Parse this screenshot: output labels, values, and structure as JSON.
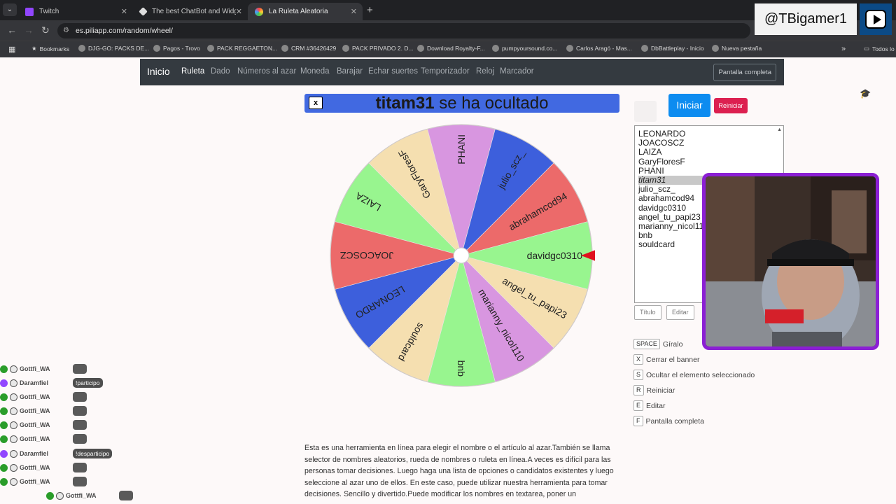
{
  "browser": {
    "tabs": [
      {
        "title": "Twitch",
        "color": "#9146ff"
      },
      {
        "title": "The best ChatBot and Widgets",
        "color": "#cccccc"
      },
      {
        "title": "La Ruleta Aleatoria",
        "color": "#f0a030"
      }
    ],
    "url": "es.piliapp.com/random/wheel/",
    "bookmarks": [
      "Bookmarks",
      "DJG-GO: PACKS DE...",
      "Pagos - Trovo",
      "PACK REGGAETON...",
      "CRM #36426429",
      "PACK PRIVADO 2. D...",
      "Download Royalty-F...",
      "pumpyoursound.co...",
      "Carlos Aragó - Mas...",
      "DbBattleplay - Inicio",
      "Nueva pestaña"
    ],
    "bookmarks_overflow": "»",
    "all_bookmarks": "Todos lo"
  },
  "nav": {
    "brand": "Inicio",
    "links": [
      "Ruleta",
      "Dado",
      "Números al azar",
      "Moneda",
      "Barajar",
      "Echar suertes",
      "Temporizador",
      "Reloj",
      "Marcador"
    ],
    "fullscreen": "Pantalla completa"
  },
  "banner": {
    "close": "x",
    "name": "titam31",
    "message": " se ha ocultado"
  },
  "controls": {
    "start": "Iniciar",
    "reset": "Reiniciar",
    "title_btn": "Título",
    "edit_btn": "Editar"
  },
  "names": [
    "LEONARDO",
    "JOACOSCZ",
    "LAIZA",
    "GaryFloresF",
    "PHANI",
    "titam31",
    "julio_scz_",
    "abrahamcod94",
    "davidgc0310",
    "angel_tu_papi23",
    "marianny_nicol110",
    "bnb",
    "souldcard"
  ],
  "selected_name": "titam31",
  "wheel": {
    "slices": [
      {
        "label": "LAIZA",
        "color": "#98f58f"
      },
      {
        "label": "GaryFloresF",
        "color": "#f5dfb0"
      },
      {
        "label": "PHANI",
        "color": "#d896e0"
      },
      {
        "label": "julio_scz_",
        "color": "#3d5fdc"
      },
      {
        "label": "abrahamcod94",
        "color": "#ec6a6a"
      },
      {
        "label": "davidgc0310",
        "color": "#98f58f"
      },
      {
        "label": "angel_tu_papi23",
        "color": "#f5dfb0"
      },
      {
        "label": "marianny_nicol110",
        "color": "#d896e0"
      },
      {
        "label": "bnb",
        "color": "#98f58f"
      },
      {
        "label": "souldcard",
        "color": "#f5dfb0"
      },
      {
        "label": "LEONARDO",
        "color": "#3d5fdc"
      },
      {
        "label": "JOACOSCZ",
        "color": "#ec6a6a"
      }
    ],
    "pointer_color": "#e0101e"
  },
  "shortcuts": [
    {
      "key": "SPACE",
      "label": "Gíralo"
    },
    {
      "key": "X",
      "label": "Cerrar el banner"
    },
    {
      "key": "S",
      "label": "Ocultar el elemento seleccionado"
    },
    {
      "key": "R",
      "label": "Reiniciar"
    },
    {
      "key": "E",
      "label": "Editar"
    },
    {
      "key": "F",
      "label": "Pantalla completa"
    }
  ],
  "description": "Esta es una herramienta en línea para elegir el nombre o el artículo al azar.También se llama selector de nombres aleatorios, rueda de nombres o ruleta en línea.A veces es difícil para las personas tomar decisiones. Luego haga una lista de opciones o candidatos existentes y luego seleccione al azar uno de ellos. En este caso, puede utilizar nuestra herramienta para tomar decisiones. Sencillo y divertido.Puede modificar los nombres en textarea, poner un",
  "stream": {
    "handle": "@TBigamer1"
  },
  "chat": [
    {
      "user": "Gottfi_WA",
      "badge": "#2a9d2a",
      "msg": ""
    },
    {
      "user": "Daramfiel",
      "badge": "#9146ff",
      "msg": "!participo"
    },
    {
      "user": "Gottfi_WA",
      "badge": "#2a9d2a",
      "msg": ""
    },
    {
      "user": "Gottfi_WA",
      "badge": "#2a9d2a",
      "msg": ""
    },
    {
      "user": "Gottfi_WA",
      "badge": "#2a9d2a",
      "msg": ""
    },
    {
      "user": "Gottfi_WA",
      "badge": "#2a9d2a",
      "msg": ""
    },
    {
      "user": "Daramfiel",
      "badge": "#9146ff",
      "msg": "!desparticipo"
    },
    {
      "user": "Gottfi_WA",
      "badge": "#2a9d2a",
      "msg": ""
    },
    {
      "user": "Gottfi_WA",
      "badge": "#2a9d2a",
      "msg": ""
    },
    {
      "user": "Gottfi_WA",
      "badge": "#2a9d2a",
      "msg": ""
    }
  ]
}
